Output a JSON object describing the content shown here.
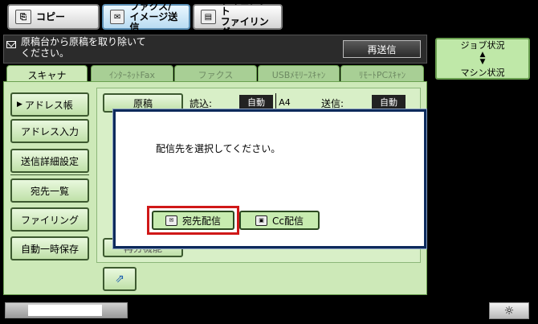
{
  "mode_buttons": [
    {
      "label": "コピー",
      "icon": "copy-icon"
    },
    {
      "label": "ファクス/\nイメージ送信",
      "icon": "fax-image-send-icon"
    },
    {
      "label": "ドキュメント\nファイリング",
      "icon": "document-filing-icon"
    }
  ],
  "message": {
    "text": "原稿台から原稿を取り除いて\nください。",
    "icon": "envelope-icon"
  },
  "resend_label": "再送信",
  "job_panel": {
    "line1": "ジョブ状況",
    "line2": "マシン状況",
    "icon": "up-down-arrows-icon"
  },
  "tabs": [
    "スキャナ",
    "ｲﾝﾀｰﾈｯﾄFax",
    "ファクス",
    "USBﾒﾓﾘｰｽｷｬﾝ",
    "ﾘﾓｰﾄPCｽｷｬﾝ"
  ],
  "side_buttons": [
    "アドレス帳",
    "アドレス入力",
    "送信詳細設定",
    "宛先一覧",
    "ファイリング",
    "自動一時保存"
  ],
  "main": {
    "original_label": "原稿",
    "read_label": "読込:",
    "read_value": "自動",
    "paper_size": "A4",
    "send_label": "送信:",
    "send_value": "自動",
    "other_button_partial": "再分機能"
  },
  "dialog": {
    "message": "配信先を選択してください。",
    "to_button": "宛先配信",
    "cc_button": "Cc配信"
  },
  "colors": {
    "panel_green": "#cde9b8",
    "dialog_border": "#0d2a5c",
    "highlight": "#d01818"
  }
}
